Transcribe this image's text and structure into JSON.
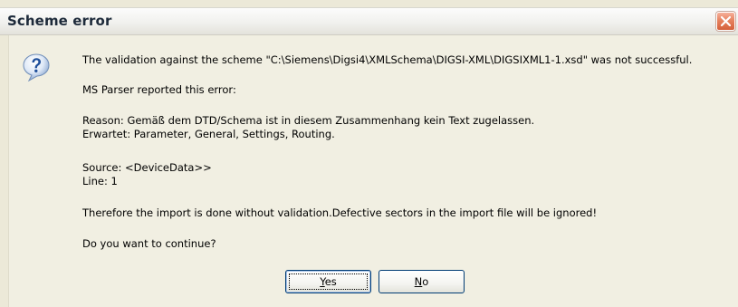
{
  "window": {
    "title": "Scheme error",
    "close_icon": "close-icon"
  },
  "dialog": {
    "icon": "question-icon",
    "lines": {
      "validation": "The validation against the scheme \"C:\\Siemens\\Digsi4\\XMLSchema\\DIGSI-XML\\DIGSIXML1-1.xsd\" was not successful.",
      "parser": "MS Parser reported this error:",
      "reason": "Reason: Gemäß dem DTD/Schema ist in diesem Zusammenhang kein Text zugelassen.",
      "expected": "Erwartet: Parameter, General, Settings, Routing.",
      "source": "Source:   <DeviceData>>",
      "line": "Line: 1",
      "therefore": "Therefore the import is done without validation.Defective sectors in the import file will be ignored!",
      "question": "Do you want to continue?"
    }
  },
  "buttons": {
    "yes": {
      "mnemonic": "Y",
      "rest": "es"
    },
    "no": {
      "mnemonic": "N",
      "rest": "o"
    }
  }
}
